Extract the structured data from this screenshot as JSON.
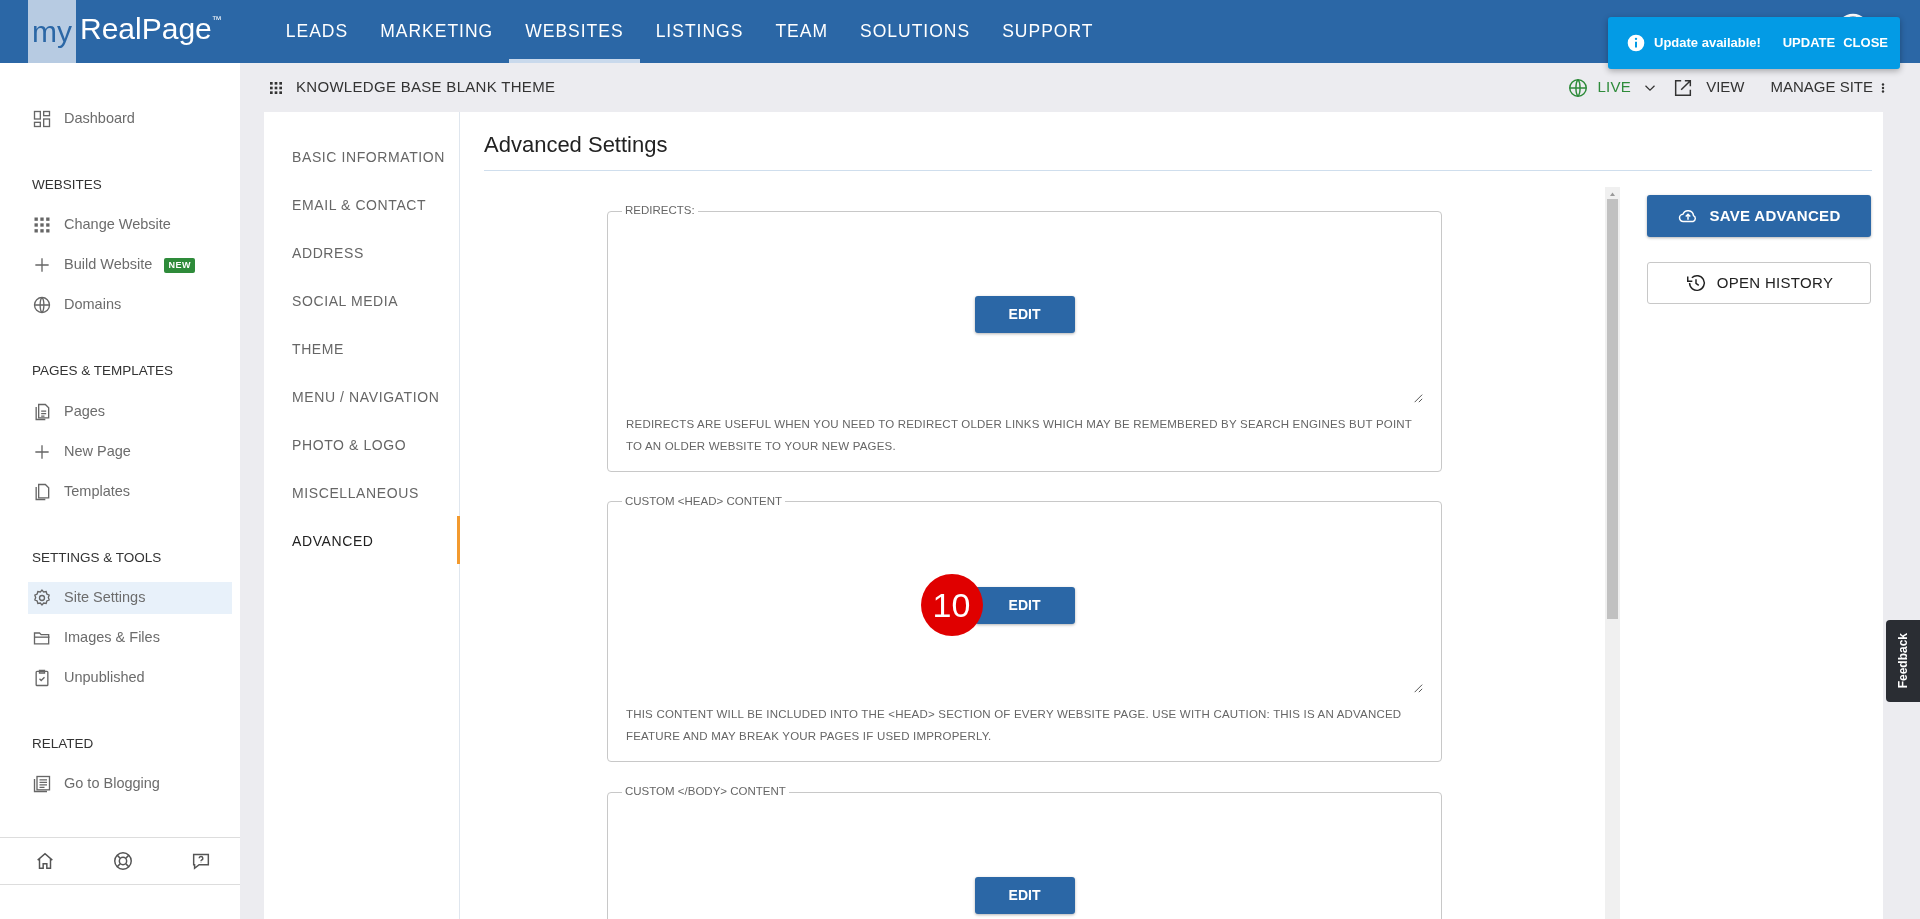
{
  "brand": {
    "prefix": "my",
    "name": "RealPage",
    "tm": "™"
  },
  "top_nav": [
    {
      "label": "LEADS",
      "selected": false
    },
    {
      "label": "MARKETING",
      "selected": false
    },
    {
      "label": "WEBSITES",
      "selected": true
    },
    {
      "label": "LISTINGS",
      "selected": false
    },
    {
      "label": "TEAM",
      "selected": false
    },
    {
      "label": "SOLUTIONS",
      "selected": false
    },
    {
      "label": "SUPPORT",
      "selected": false
    }
  ],
  "toast": {
    "message": "Update available!",
    "actions": [
      "UPDATE",
      "CLOSE"
    ]
  },
  "sidebar": {
    "sections": [
      {
        "items": [
          {
            "label": "Dashboard",
            "selected": false
          }
        ]
      },
      {
        "heading": "WEBSITES",
        "items": [
          {
            "label": "Change Website",
            "selected": false
          },
          {
            "label": "Build Website",
            "badge": "NEW",
            "selected": false
          },
          {
            "label": "Domains",
            "selected": false
          }
        ]
      },
      {
        "heading": "PAGES & TEMPLATES",
        "items": [
          {
            "label": "Pages",
            "selected": false
          },
          {
            "label": "New Page",
            "selected": false
          },
          {
            "label": "Templates",
            "selected": false
          }
        ]
      },
      {
        "heading": "SETTINGS & TOOLS",
        "items": [
          {
            "label": "Site Settings",
            "selected": true
          },
          {
            "label": "Images & Files",
            "selected": false
          },
          {
            "label": "Unpublished",
            "selected": false
          }
        ]
      },
      {
        "heading": "RELATED",
        "items": [
          {
            "label": "Go to Blogging",
            "selected": false
          }
        ]
      }
    ]
  },
  "site_bar": {
    "title": "KNOWLEDGE BASE BLANK THEME",
    "status": "LIVE",
    "view": "VIEW",
    "manage": "MANAGE SITE"
  },
  "settings_nav": [
    {
      "label": "BASIC INFORMATION",
      "selected": false
    },
    {
      "label": "EMAIL & CONTACT",
      "selected": false
    },
    {
      "label": "ADDRESS",
      "selected": false
    },
    {
      "label": "SOCIAL MEDIA",
      "selected": false
    },
    {
      "label": "THEME",
      "selected": false
    },
    {
      "label": "MENU / NAVIGATION",
      "selected": false
    },
    {
      "label": "PHOTO & LOGO",
      "selected": false
    },
    {
      "label": "MISCELLANEOUS",
      "selected": false
    },
    {
      "label": "ADVANCED",
      "selected": true
    }
  ],
  "content": {
    "title": "Advanced Settings",
    "fieldsets": [
      {
        "legend": "REDIRECTS:",
        "button": "EDIT",
        "help": "REDIRECTS ARE USEFUL WHEN YOU NEED TO REDIRECT OLDER LINKS WHICH MAY BE REMEMBERED BY SEARCH ENGINES BUT POINT TO AN OLDER WEBSITE TO YOUR NEW PAGES."
      },
      {
        "legend": "CUSTOM <HEAD> CONTENT",
        "button": "EDIT",
        "marker": "10",
        "help": "THIS CONTENT WILL BE INCLUDED INTO THE <HEAD> SECTION OF EVERY WEBSITE PAGE. USE WITH CAUTION: THIS IS AN ADVANCED FEATURE AND MAY BREAK YOUR PAGES IF USED IMPROPERLY."
      },
      {
        "legend": "CUSTOM </BODY> CONTENT",
        "button": "EDIT"
      }
    ],
    "actions": [
      {
        "label": "SAVE ADVANCED",
        "kind": "primary"
      },
      {
        "label": "OPEN HISTORY",
        "kind": "outline"
      }
    ]
  },
  "feedback": "Feedback"
}
